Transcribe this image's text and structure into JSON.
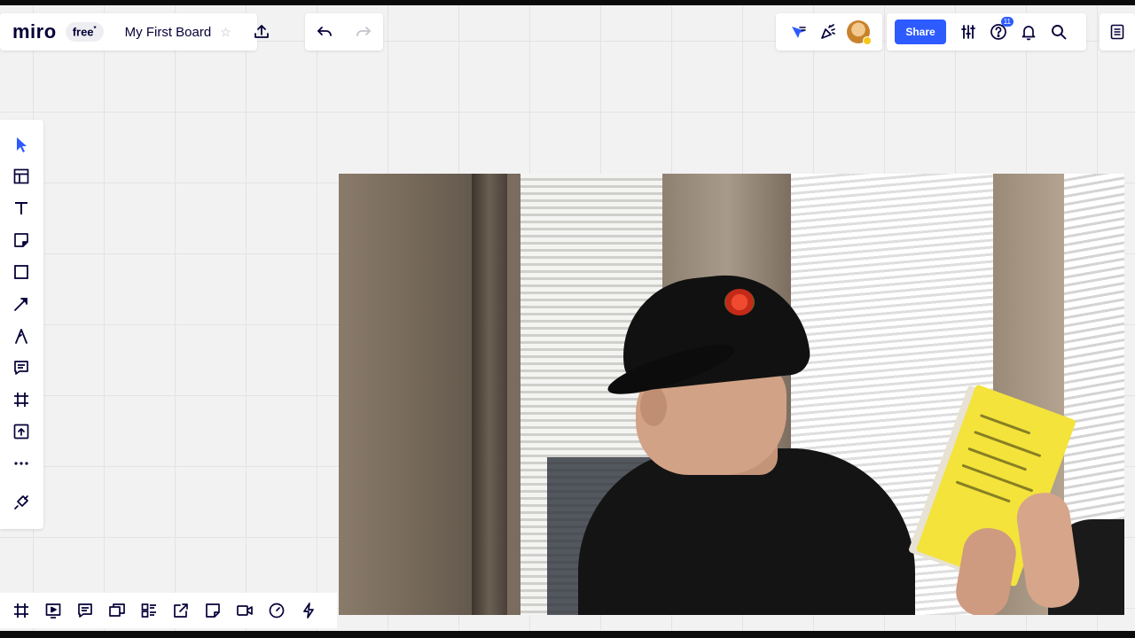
{
  "header": {
    "logo": "miro",
    "plan_badge": "free",
    "plan_badge_mark": "*",
    "board_title": "My First Board",
    "share_label": "Share",
    "help_badge_count": "11"
  },
  "icons": {
    "favorite": "star-icon",
    "export": "upload-icon",
    "undo": "undo-icon",
    "redo": "redo-icon",
    "cursor_tracking": "cursor-tracking-icon",
    "reactions": "celebrate-icon",
    "settings": "sliders-icon",
    "help": "question-icon",
    "notifications": "bell-icon",
    "search": "search-icon",
    "board_list": "list-icon"
  },
  "left_toolbar": {
    "tools": [
      "select",
      "templates",
      "text",
      "sticky-note",
      "shape",
      "connection-line",
      "pen",
      "comment",
      "frame",
      "upload",
      "more",
      "apps"
    ]
  },
  "bottom_toolbar": {
    "tools": [
      "frames",
      "presentation",
      "comments",
      "screen-share",
      "cards",
      "share-link",
      "sticky",
      "video",
      "timer",
      "activity"
    ]
  },
  "colors": {
    "accent": "#2d5bff",
    "ink": "#050038",
    "canvas": "#f2f2f2"
  }
}
